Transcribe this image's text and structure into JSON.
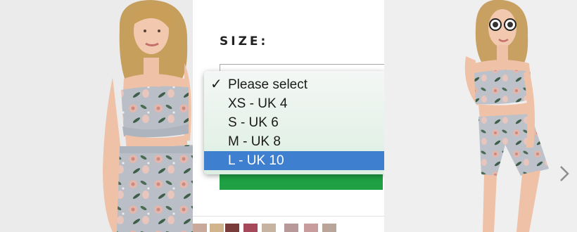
{
  "size_selector": {
    "label": "SIZE:",
    "options": [
      {
        "label": "Please select",
        "checked": true,
        "highlighted": false
      },
      {
        "label": "XS - UK 4",
        "checked": false,
        "highlighted": false
      },
      {
        "label": "S - UK 6",
        "checked": false,
        "highlighted": false
      },
      {
        "label": "M - UK 8",
        "checked": false,
        "highlighted": false
      },
      {
        "label": "L - UK 10",
        "checked": false,
        "highlighted": true
      }
    ],
    "check_glyph": "✓"
  },
  "colors": {
    "highlight": "#3f7fcf",
    "button_green": "#1ea043",
    "print_base": "#b9bec7"
  },
  "icons": {
    "next": "chevron-right-icon"
  }
}
